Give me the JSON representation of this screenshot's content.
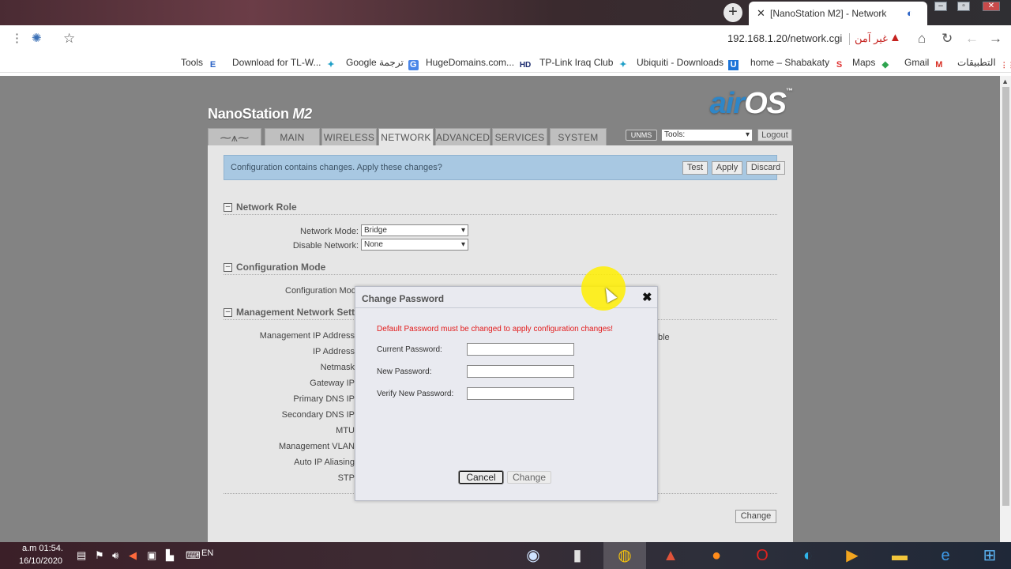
{
  "browser": {
    "tab_title": "[NanoStation M2] - Network",
    "url": "192.168.1.20/network.cgi",
    "security_label": "غير آمن",
    "bookmarks": [
      {
        "label": "Tools",
        "icon": "E"
      },
      {
        "label": "Download for TL-W...",
        "icon": "✦"
      },
      {
        "label": "Google ترجمة",
        "icon": "G"
      },
      {
        "label": "HugeDomains.com...",
        "icon": "HD"
      },
      {
        "label": "TP-Link Iraq Club",
        "icon": "✦"
      },
      {
        "label": "Ubiquiti - Downloads",
        "icon": "U"
      },
      {
        "label": "home – Shabakaty",
        "icon": "S"
      },
      {
        "label": "Maps",
        "icon": "◆"
      },
      {
        "label": "Gmail",
        "icon": "M"
      },
      {
        "label": "التطبيقات",
        "icon": "⋮⋮"
      }
    ]
  },
  "header": {
    "device_name": "NanoStation",
    "device_model": "M2",
    "logo_air": "air",
    "logo_os": "OS",
    "logo_tm": "™"
  },
  "nav": {
    "tabs": [
      "MAIN",
      "WIRELESS",
      "NETWORK",
      "ADVANCED",
      "SERVICES",
      "SYSTEM"
    ],
    "active": "NETWORK",
    "unms_label": "UNMS",
    "tools_value": "Tools:",
    "logout_label": "Logout"
  },
  "notice": {
    "text": "Configuration contains changes. Apply these changes?",
    "test": "Test",
    "apply": "Apply",
    "discard": "Discard"
  },
  "network_role": {
    "title": "Network Role",
    "network_mode_label": "Network Mode:",
    "network_mode_value": "Bridge",
    "disable_network_label": "Disable Network:",
    "disable_network_value": "None"
  },
  "config_mode": {
    "title": "Configuration Mode",
    "label": "Configuration Mode"
  },
  "management": {
    "title": "Management Network Settin",
    "right_text": "ble",
    "fields": [
      "Management IP Address",
      "IP Address",
      "Netmask",
      "Gateway IP",
      "Primary DNS IP",
      "Secondary DNS IP",
      "MTU",
      "Management VLAN",
      "Auto IP Aliasing",
      "STP"
    ]
  },
  "page_change_label": "Change",
  "modal": {
    "title": "Change Password",
    "close": "✖",
    "error": "Default Password must be changed to apply configuration changes!",
    "current_password_label": "Current Password:",
    "new_password_label": "New Password:",
    "verify_password_label": "Verify New Password:",
    "cancel": "Cancel",
    "change": "Change"
  },
  "taskbar": {
    "time": "a.m 01:54.",
    "date": "16/10/2020",
    "lang": "EN"
  }
}
